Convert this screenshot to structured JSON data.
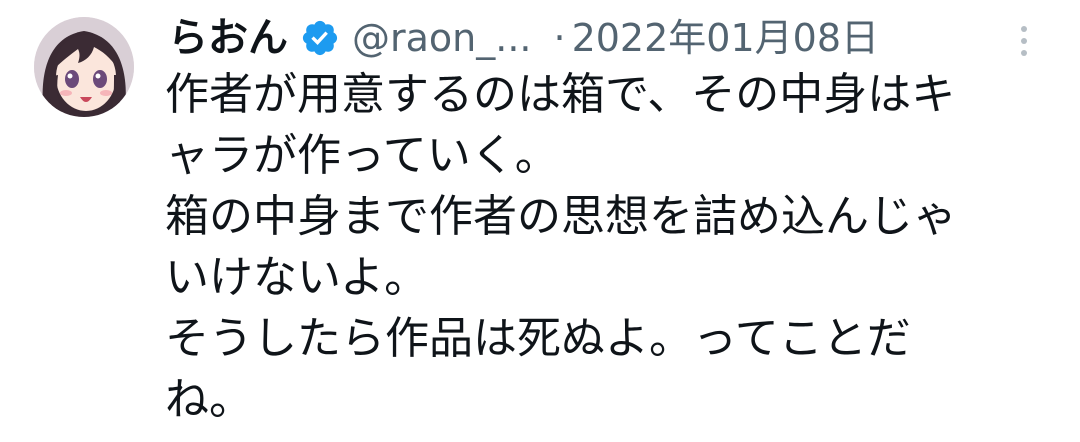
{
  "tweet": {
    "display_name": "らおん",
    "handle": "@raon_...",
    "separator": "·",
    "timestamp": "2022年01月08日",
    "text_lines": [
      "作者が用意するのは箱で、その中身はキ",
      "ャラが作っていく。",
      "箱の中身まで作者の思想を詰め込んじゃ",
      "いけないよ。",
      "そうしたら作品は死ぬよ。ってことだ",
      "ね。"
    ]
  },
  "icons": {
    "verified": "verified-badge-icon",
    "more": "more-options-icon"
  },
  "colors": {
    "verified_blue": "#1d9bf0",
    "secondary_text": "#536471",
    "primary_text": "#0f1419"
  }
}
